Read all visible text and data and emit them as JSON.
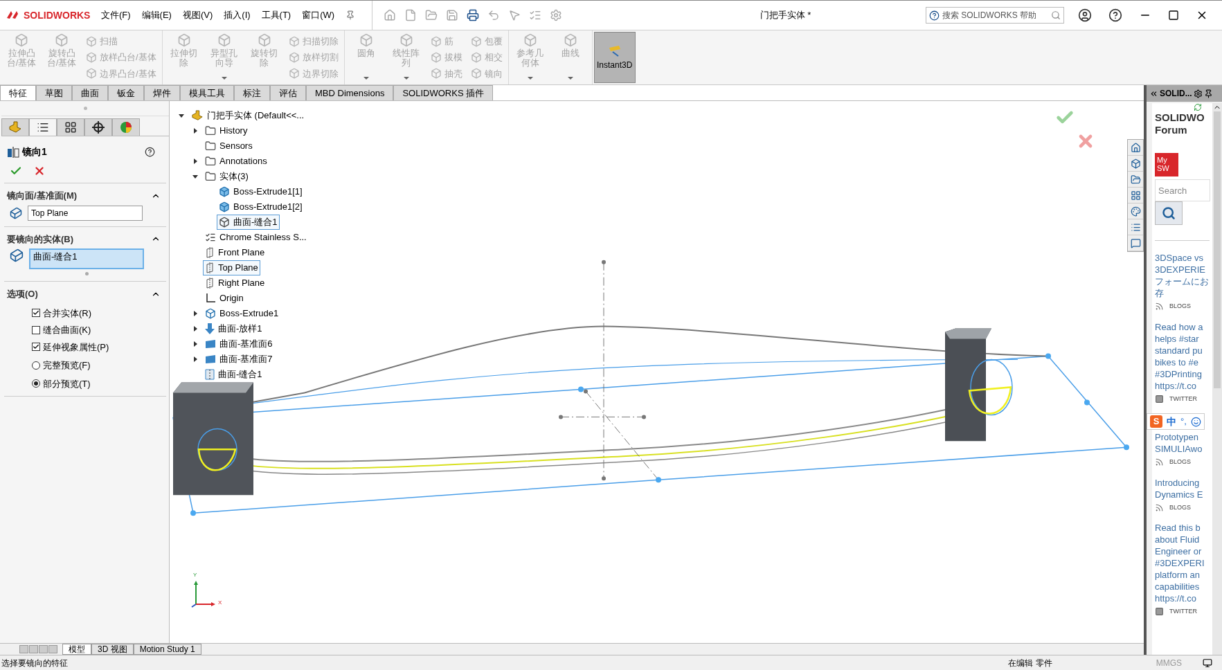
{
  "app": {
    "logo": "SOLIDWORKS",
    "title": "门把手实体 *",
    "search": {
      "placeholder": "搜索 SOLIDWORKS 帮助"
    }
  },
  "menus": [
    "文件(F)",
    "编辑(E)",
    "视图(V)",
    "插入(I)",
    "工具(T)",
    "窗口(W)"
  ],
  "ribbon": {
    "disabled": true,
    "groups": [
      [
        {
          "kind": "big",
          "label": "拉伸凸台/基体",
          "dropdown": false
        },
        {
          "kind": "big",
          "label": "旋转凸台/基体",
          "dropdown": false
        },
        {
          "kind": "small",
          "items": [
            "扫描",
            "放样凸台/基体",
            "边界凸台/基体"
          ]
        }
      ],
      [
        {
          "kind": "big",
          "label": "拉伸切除",
          "dropdown": false
        },
        {
          "kind": "big",
          "label": "异型孔向导",
          "dropdown": true
        },
        {
          "kind": "big",
          "label": "旋转切除",
          "dropdown": false
        },
        {
          "kind": "small",
          "items": [
            "扫描切除",
            "放样切割",
            "边界切除"
          ]
        }
      ],
      [
        {
          "kind": "big",
          "label": "圆角",
          "dropdown": true
        },
        {
          "kind": "big",
          "label": "线性阵列",
          "dropdown": true
        },
        {
          "kind": "small",
          "items": [
            "筋",
            "拔模",
            "抽壳"
          ]
        },
        {
          "kind": "small",
          "items": [
            "包覆",
            "相交",
            "镜向"
          ]
        }
      ],
      [
        {
          "kind": "big",
          "label": "参考几何体",
          "dropdown": true
        },
        {
          "kind": "big",
          "label": "曲线",
          "dropdown": true
        }
      ]
    ],
    "instant3d": {
      "label": "Instant3D",
      "selected": true
    }
  },
  "tabs": [
    {
      "label": "特征",
      "selected": true
    },
    {
      "label": "草图",
      "selected": false
    },
    {
      "label": "曲面",
      "selected": false
    },
    {
      "label": "钣金",
      "selected": false
    },
    {
      "label": "焊件",
      "selected": false
    },
    {
      "label": "模具工具",
      "selected": false
    },
    {
      "label": "标注",
      "selected": false
    },
    {
      "label": "评估",
      "selected": false
    },
    {
      "label": "MBD Dimensions",
      "selected": false
    },
    {
      "label": "SOLIDWORKS 插件",
      "selected": false
    }
  ],
  "property_manager": {
    "panel_tabs": [
      {
        "kind": "part",
        "selected": false
      },
      {
        "kind": "list",
        "selected": true
      },
      {
        "kind": "config",
        "selected": false
      },
      {
        "kind": "target",
        "selected": false
      },
      {
        "kind": "appearance",
        "selected": false
      }
    ],
    "title": "镜向1",
    "sections": [
      {
        "kind": "field",
        "title": "镜向面/基准面(M)",
        "value": "Top Plane"
      },
      {
        "kind": "list",
        "title": "要镜向的实体(B)",
        "value": "曲面-缝合1"
      },
      {
        "kind": "options",
        "title": "选项(O)",
        "checkboxes": [
          {
            "label": "合并实体(R)",
            "checked": true
          },
          {
            "label": "缝合曲面(K)",
            "checked": false
          },
          {
            "label": "延伸视象属性(P)",
            "checked": true
          }
        ],
        "radios": [
          {
            "label": "完整预览(F)",
            "selected": false
          },
          {
            "label": "部分预览(T)",
            "selected": true
          }
        ]
      }
    ]
  },
  "tree": {
    "label": "门把手实体  (Default<<...",
    "kind": "part",
    "expanded": true,
    "selected": false,
    "children": [
      {
        "label": "History",
        "kind": "history",
        "expanded": false,
        "selected": false
      },
      {
        "label": "Sensors",
        "kind": "sensors",
        "selected": false
      },
      {
        "label": "Annotations",
        "kind": "annotations",
        "expanded": false,
        "selected": false
      },
      {
        "label": "实体(3)",
        "kind": "solids",
        "expanded": true,
        "selected": false,
        "children": [
          {
            "label": "Boss-Extrude1[1]",
            "kind": "body",
            "selected": false
          },
          {
            "label": "Boss-Extrude1[2]",
            "kind": "body",
            "selected": false
          },
          {
            "label": "曲面-缝合1",
            "kind": "surface-body",
            "selected": true
          }
        ]
      },
      {
        "label": "Chrome Stainless S...",
        "kind": "material",
        "selected": false
      },
      {
        "label": "Front Plane",
        "kind": "plane",
        "selected": false
      },
      {
        "label": "Top Plane",
        "kind": "plane",
        "selected": true
      },
      {
        "label": "Right Plane",
        "kind": "plane",
        "selected": false
      },
      {
        "label": "Origin",
        "kind": "origin",
        "selected": false
      },
      {
        "label": "Boss-Extrude1",
        "kind": "extrude",
        "expanded": false,
        "selected": false
      },
      {
        "label": "曲面-放样1",
        "kind": "loft",
        "expanded": false,
        "selected": false
      },
      {
        "label": "曲面-基准面6",
        "kind": "surface",
        "expanded": false,
        "selected": false
      },
      {
        "label": "曲面-基准面7",
        "kind": "surface",
        "expanded": false,
        "selected": false
      },
      {
        "label": "曲面-缝合1",
        "kind": "knit",
        "selected": false
      }
    ]
  },
  "triad": {
    "x": "X",
    "y": "Y"
  },
  "task_pane": {
    "header": "SOLID...",
    "forum_title": "SOLIDWO",
    "forum_subtitle": "Forum",
    "logo": "My\nSW",
    "search": {
      "placeholder": "Search"
    },
    "posts": [
      {
        "lines": [
          "3DSpace vs",
          "3DEXPERIE",
          "フォームにお",
          "存"
        ],
        "source": "BLOGS",
        "kind": "blog"
      },
      {
        "lines": [
          "Read how a",
          "helps #star",
          "standard pu",
          "bikes to #e",
          "#3DPrinting",
          "https://t.co"
        ],
        "source": "TWITTER",
        "kind": "twitter"
      },
      {
        "lines": [
          "Prototypen",
          "SIMULIAwo"
        ],
        "source": "BLOGS",
        "kind": "blog"
      },
      {
        "lines": [
          "Introducing",
          "Dynamics E"
        ],
        "source": "BLOGS",
        "kind": "blog"
      },
      {
        "lines": [
          "Read this b",
          "about Fluid",
          "Engineer or",
          "#3DEXPERI",
          "platform an",
          "capabilities",
          "https://t.co"
        ],
        "source": "TWITTER",
        "kind": "twitter"
      }
    ]
  },
  "ime_bar": {
    "logo": "S",
    "mode": "中",
    "punct": "°,"
  },
  "bottom_tabs": [
    {
      "label": "模型",
      "selected": true
    },
    {
      "label": "3D 视图",
      "selected": false
    },
    {
      "label": "Motion Study 1",
      "selected": false
    }
  ],
  "status_bar": {
    "message": "选择要镜向的特征",
    "mode": "在编辑 零件",
    "units": "MMGS"
  }
}
